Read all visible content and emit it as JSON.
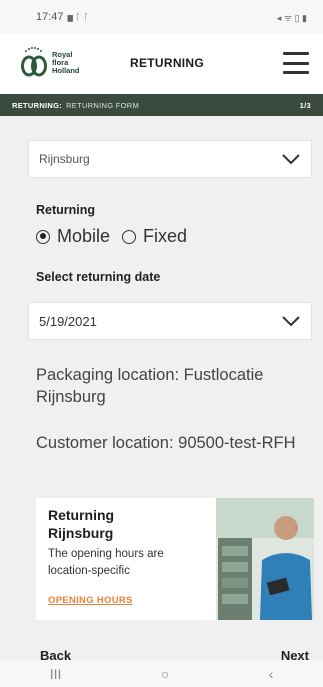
{
  "status": {
    "time": "17:47",
    "left_icons": "▆ ᛚ ᛚ",
    "right_icons": "◂ ᯤ ▯ ▮"
  },
  "header": {
    "logo_lines": [
      "Royal",
      "flora",
      "Holland"
    ],
    "title": "RETURNING"
  },
  "progress": {
    "section": "RETURNING:",
    "label": "RETURNING FORM",
    "step": "1/3"
  },
  "form": {
    "location_value": "Rijnsburg",
    "returning_label": "Returning",
    "returning_options": [
      {
        "label": "Mobile",
        "selected": true
      },
      {
        "label": "Fixed",
        "selected": false
      }
    ],
    "date_label": "Select returning date",
    "date_value": "5/19/2021",
    "packaging_text": "Packaging location: Fustlocatie Rijnsburg",
    "customer_text": "Customer location: 90500-test-RFH"
  },
  "promo": {
    "title_line1": "Returning",
    "title_line2": "Rijnsburg",
    "description": "The opening hours are location-specific",
    "link": "OPENING HOURS"
  },
  "footer": {
    "back": "Back",
    "next": "Next"
  },
  "sys_nav": {
    "recent": "III",
    "home": "○",
    "back": "‹"
  },
  "colors": {
    "brand_green": "#3b4a3f",
    "accent_orange": "#e8833a"
  }
}
